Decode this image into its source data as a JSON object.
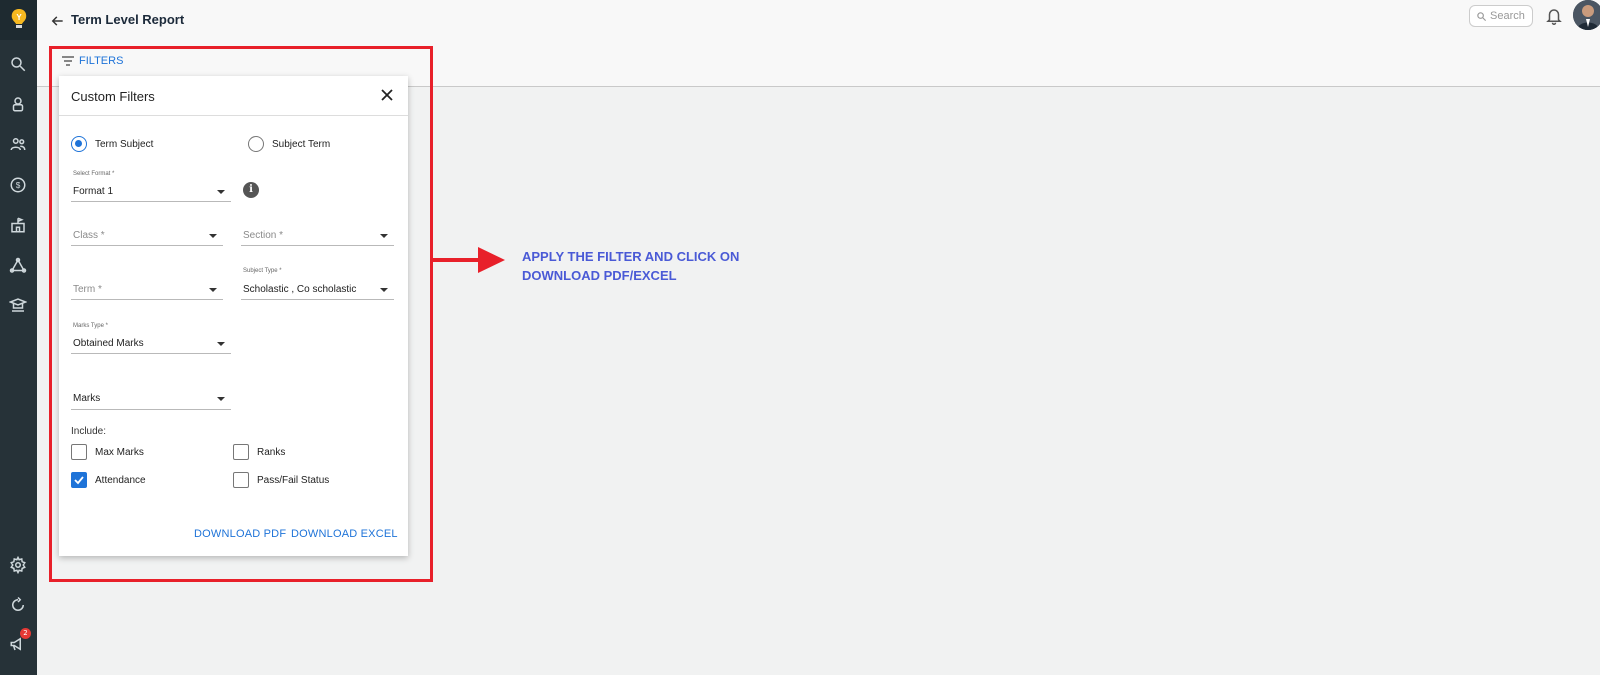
{
  "header": {
    "title": "Term Level Report",
    "filters_label": "FILTERS",
    "search_placeholder": "Search"
  },
  "sidebar": {
    "items": [
      {
        "icon": "search-icon"
      },
      {
        "icon": "student-icon"
      },
      {
        "icon": "people-icon"
      },
      {
        "icon": "fees-dollar-icon"
      },
      {
        "icon": "school-building-icon"
      },
      {
        "icon": "network-icon"
      },
      {
        "icon": "teacher-icon"
      },
      {
        "icon": "settings-gear-icon"
      },
      {
        "icon": "refresh-icon"
      },
      {
        "icon": "announcement-megaphone-icon",
        "badge": "2"
      }
    ]
  },
  "popup": {
    "title": "Custom Filters",
    "radio_options": [
      "Term Subject",
      "Subject Term"
    ],
    "selected_radio": "Term Subject",
    "select_format": {
      "label": "Select Format *",
      "value": "Format 1"
    },
    "class": {
      "placeholder": "Class *"
    },
    "section": {
      "placeholder": "Section *"
    },
    "term": {
      "placeholder": "Term *"
    },
    "subject_type": {
      "label": "Subject Type *",
      "value": "Scholastic , Co scholastic"
    },
    "marks_type": {
      "label": "Marks Type *",
      "value": "Obtained Marks"
    },
    "marks": {
      "value": "Marks"
    },
    "include_label": "Include:",
    "checkboxes": [
      {
        "label": "Max Marks",
        "checked": false
      },
      {
        "label": "Ranks",
        "checked": false
      },
      {
        "label": "Attendance",
        "checked": true
      },
      {
        "label": "Pass/Fail Status",
        "checked": false
      }
    ],
    "download_pdf": "DOWNLOAD PDF",
    "download_excel": "DOWNLOAD EXCEL"
  },
  "annotation": {
    "line1": "APPLY THE FILTER AND CLICK ON",
    "line2": "DOWNLOAD PDF/EXCEL"
  },
  "colors": {
    "sidebar": "#263238",
    "accent": "#1e73d8",
    "highlight": "#e8202a",
    "annotation": "#4a5ad6"
  }
}
